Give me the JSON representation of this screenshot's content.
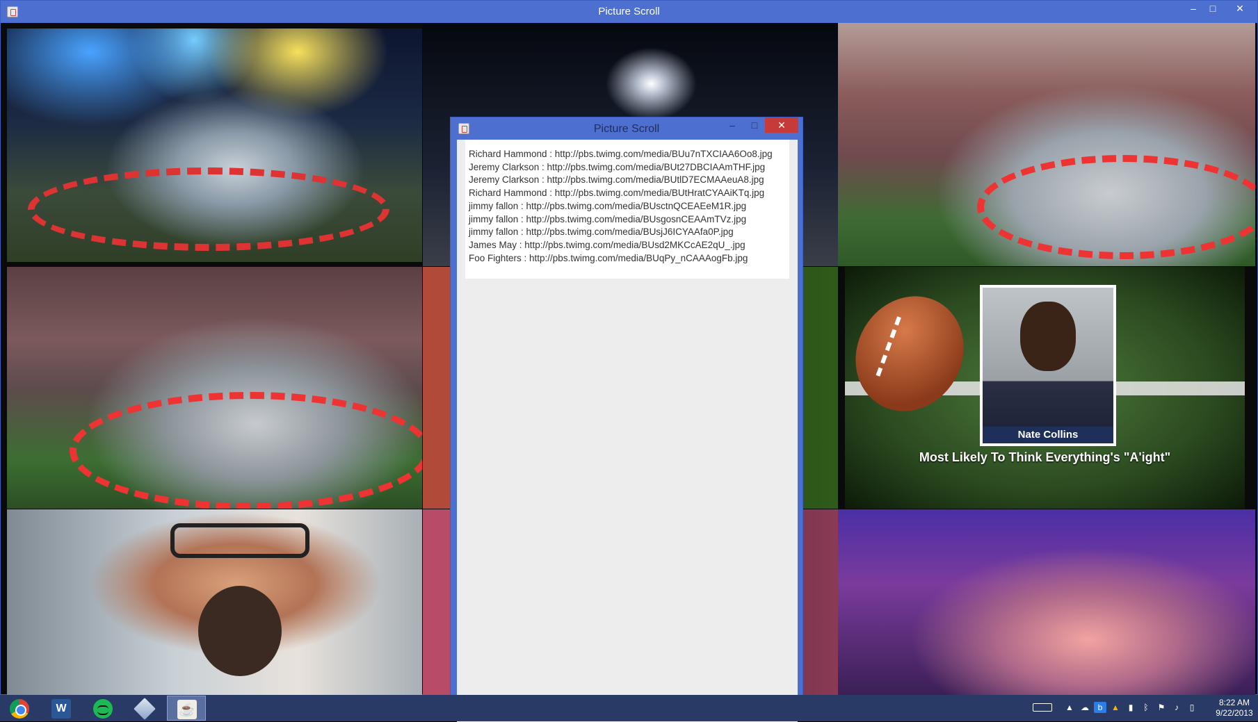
{
  "window": {
    "title": "Picture Scroll",
    "controls": {
      "minimize": "–",
      "maximize": "□",
      "close": "✕"
    }
  },
  "tiles": {
    "nate_collins_name": "Nate Collins",
    "nate_collins_caption": "Most Likely To Think Everything's \"A'ight\""
  },
  "dialog": {
    "title": "Picture Scroll",
    "controls": {
      "minimize": "–",
      "maximize": "□",
      "close": "✕"
    },
    "lines": [
      "Richard Hammond : http://pbs.twimg.com/media/BUu7nTXCIAA6Oo8.jpg",
      "Jeremy Clarkson : http://pbs.twimg.com/media/BUt27DBCIAAmTHF.jpg",
      "Jeremy Clarkson : http://pbs.twimg.com/media/BUtlD7ECMAAeuA8.jpg",
      "Richard Hammond : http://pbs.twimg.com/media/BUtHratCYAAiKTq.jpg",
      "jimmy fallon : http://pbs.twimg.com/media/BUsctnQCEAEeM1R.jpg",
      "jimmy fallon : http://pbs.twimg.com/media/BUsgosnCEAAmTVz.jpg",
      "jimmy fallon : http://pbs.twimg.com/media/BUsjJ6ICYAAfa0P.jpg",
      "James May : http://pbs.twimg.com/media/BUsd2MKCcAE2qU_.jpg",
      "Foo Fighters : http://pbs.twimg.com/media/BUqPy_nCAAAogFb.jpg"
    ]
  },
  "taskbar": {
    "apps": [
      "chrome-icon",
      "word-icon",
      "spotify-icon",
      "virtualbox-icon",
      "java-icon"
    ],
    "word_glyph": "W",
    "java_glyph": "☕",
    "tray_icons": [
      "keyboard-icon",
      "show-hidden-icon",
      "onedrive-icon",
      "box-icon",
      "drive-icon",
      "signal-icon",
      "bluetooth-icon",
      "flag-icon",
      "volume-icon",
      "power-icon"
    ],
    "clock_time": "8:22 AM",
    "clock_date": "9/22/2013"
  },
  "colors": {
    "titlebar": "#4d6fd0",
    "close_button": "#c73a3a",
    "taskbar": "#2a3a66"
  }
}
